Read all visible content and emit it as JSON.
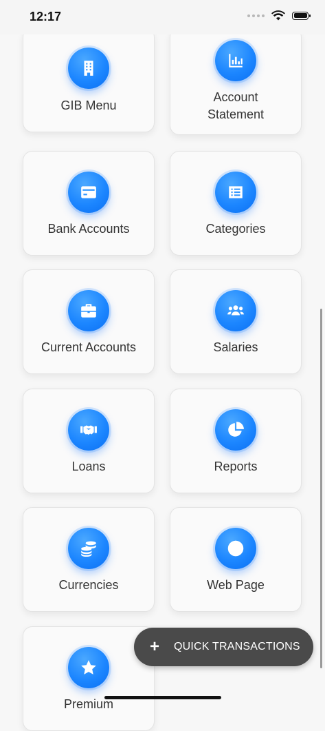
{
  "status": {
    "time": "12:17"
  },
  "menu": {
    "gib_menu": {
      "label": "GIB Menu",
      "icon": "building-icon"
    },
    "account_statement": {
      "label": "Account\nStatement",
      "icon": "chart-icon"
    },
    "bank_accounts": {
      "label": "Bank Accounts",
      "icon": "credit-card-icon"
    },
    "categories": {
      "label": "Categories",
      "icon": "list-icon"
    },
    "current_accounts": {
      "label": "Current Accounts",
      "icon": "briefcase-icon"
    },
    "salaries": {
      "label": "Salaries",
      "icon": "users-icon"
    },
    "loans": {
      "label": "Loans",
      "icon": "handshake-icon"
    },
    "reports": {
      "label": "Reports",
      "icon": "pie-chart-icon"
    },
    "currencies": {
      "label": "Currencies",
      "icon": "coins-icon"
    },
    "web_page": {
      "label": "Web Page",
      "icon": "globe-icon"
    },
    "premium": {
      "label": "Premium",
      "icon": "star-icon"
    }
  },
  "fab": {
    "label": "QUICK TRANSACTIONS",
    "icon": "plus-icon"
  },
  "colors": {
    "accent": "#1c86ff",
    "fab_bg": "#4a4a4a"
  }
}
